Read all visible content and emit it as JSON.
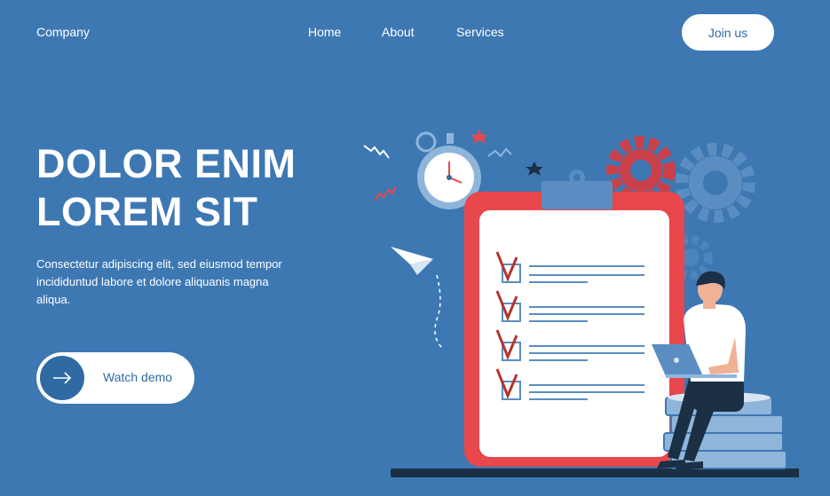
{
  "nav": {
    "brand": "Company",
    "links": [
      {
        "label": "Home"
      },
      {
        "label": "About"
      },
      {
        "label": "Services"
      }
    ],
    "cta": "Join us"
  },
  "hero": {
    "title_line1": "DOLOR ENIM",
    "title_line2": "LOREM SIT",
    "subtitle": "Consectetur adipiscing elit, sed eiusmod tempor incididuntud labore et dolore aliquanis  magna aliqua.",
    "demo_label": "Watch demo",
    "demo_icon": "arrow-right-icon"
  },
  "colors": {
    "background": "#3d78b3",
    "accent": "#2f6aa3",
    "clipboard_red": "#e8474c",
    "check_red": "#b3342f"
  },
  "illustration": {
    "icons": [
      "paper-plane-icon",
      "stopwatch-icon",
      "gear-icon",
      "star-icon",
      "checklist-clipboard-icon",
      "coin-stack-icon",
      "person-with-laptop"
    ]
  }
}
